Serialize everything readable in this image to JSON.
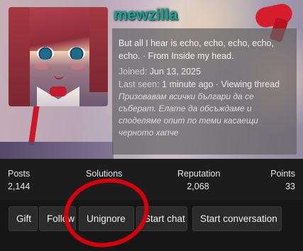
{
  "profile": {
    "username": "mewzilla",
    "about": "But all I hear is echo, echo, echo, echo, echo. · From Inside my head.",
    "joined_label": "Joined:",
    "joined_value": "Jun 13, 2025",
    "last_seen_label": "Last seen:",
    "last_seen_value": "1 minute ago · Viewing thread",
    "signature": "Призовавам всички българи да се съберат. Елате да обсъждаме и споделяме опит по теми касаещи черното хапче",
    "username_color": "#1aa295"
  },
  "stats": {
    "posts_label": "Posts",
    "posts_value": "2,144",
    "solutions_label": "Solutions",
    "solutions_value": "",
    "reputation_label": "Reputation",
    "reputation_value": "2,068",
    "points_label": "Points",
    "points_value": "33"
  },
  "actions": {
    "gift": "Gift",
    "follow": "Follow",
    "unignore": "Unignore",
    "start_chat": "Start chat",
    "start_conversation": "Start conversation"
  },
  "annotation": {
    "color": "#d4000c",
    "shape": "hand-drawn-circle"
  }
}
